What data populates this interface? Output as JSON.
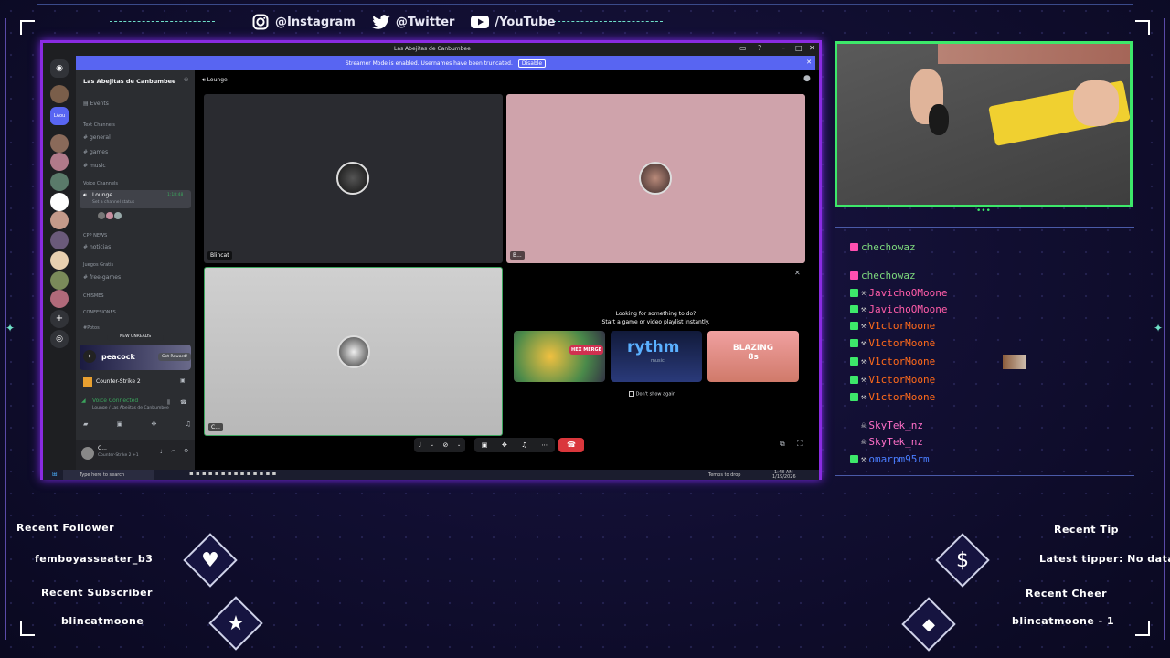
{
  "social": {
    "instagram": "@Instagram",
    "twitter": "@Twitter",
    "youtube": "/YouTube"
  },
  "discord": {
    "window_title": "Las Abejitas de Canbumbee",
    "banner_text": "Streamer Mode is enabled. Usernames have been truncated.",
    "banner_button": "Disable",
    "server_name": "Las Abejitas de Canbumbee",
    "events": "Events",
    "cat_text": "Text Channels",
    "ch_general": "general",
    "ch_games": "games",
    "ch_music": "music",
    "cat_voice": "Voice Channels",
    "ch_lounge": "Lounge",
    "lounge_time": "1:18:48",
    "lounge_status": "Set a channel status",
    "cat_cpp": "CPP NEWS",
    "ch_noticias": "noticias",
    "cat_juegos": "Juegos Gratis",
    "ch_free": "free-games",
    "cat_chismes": "CHISMES",
    "cat_conf": "CONFESIONES",
    "cat_potos": "#Potos",
    "new_unreads": "NEW UNREADS",
    "promo_brand": "peacock",
    "promo_button": "Get Reward!",
    "activity": "Counter-Strike 2",
    "voice_connected": "Voice Connected",
    "voice_location": "Lounge / Las Abejitas de Canbumbee",
    "user_name": "C...",
    "user_status": "Counter-Strike 2 +1",
    "channel_header": "Lounge",
    "tile1_label": "Blincat",
    "tile2_label": "B...",
    "tile3_label": "C...",
    "activity_title": "Looking for something to do?",
    "activity_sub": "Start a game or video playlist instantly.",
    "dont_show": "Don't show again",
    "act1": "HEX MERGE",
    "act2": "rythm",
    "act2_sub": "music",
    "act3": "BLAZING 8s",
    "tb_search": "Type here to search",
    "tb_weather": "Temps to drop",
    "tb_time": "1:48 AM",
    "tb_date": "1/19/2026"
  },
  "chat": [
    {
      "user": "chechowaz",
      "color": "#7dd87d"
    },
    {
      "user": "chechowaz",
      "color": "#7dd87d"
    },
    {
      "user": "JavichoOMoone",
      "color": "#ff5ca8"
    },
    {
      "user": "JavichoOMoone",
      "color": "#ff5ca8"
    },
    {
      "user": "V1ctorMoone",
      "color": "#ff6a1a"
    },
    {
      "user": "V1ctorMoone",
      "color": "#ff6a1a"
    },
    {
      "user": "V1ctorMoone",
      "color": "#ff6a1a"
    },
    {
      "user": "V1ctorMoone",
      "color": "#ff6a1a"
    },
    {
      "user": "V1ctorMoone",
      "color": "#ff6a1a"
    },
    {
      "user": "SkyTek_nz",
      "color": "#ff6fc8"
    },
    {
      "user": "SkyTek_nz",
      "color": "#ff6fc8"
    },
    {
      "user": "omarpm95rm",
      "color": "#4a7dff"
    }
  ],
  "widgets": {
    "recent_follower_label": "Recent Follower",
    "recent_follower": "femboyasseater_b3",
    "recent_sub_label": "Recent Subscriber",
    "recent_sub": "blincatmoone",
    "recent_tip_label": "Recent Tip",
    "recent_tip": "Latest tipper: No data",
    "recent_cheer_label": "Recent Cheer",
    "recent_cheer": "blincatmoone - 1"
  }
}
